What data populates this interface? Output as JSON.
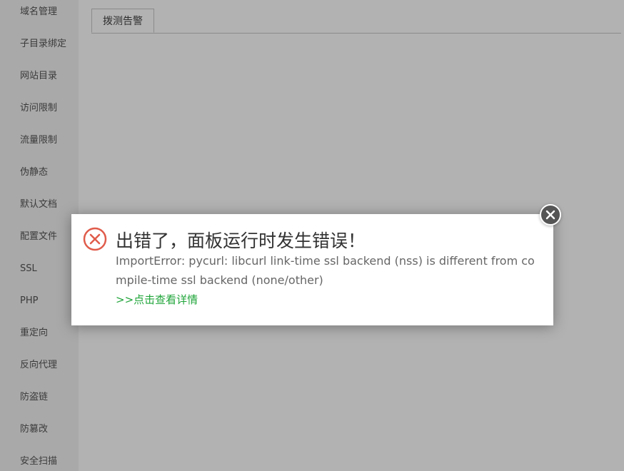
{
  "sidebar": {
    "items": [
      {
        "label": "域名管理"
      },
      {
        "label": "子目录绑定"
      },
      {
        "label": "网站目录"
      },
      {
        "label": "访问限制"
      },
      {
        "label": "流量限制"
      },
      {
        "label": "伪静态"
      },
      {
        "label": "默认文档"
      },
      {
        "label": "配置文件"
      },
      {
        "label": "SSL"
      },
      {
        "label": "PHP"
      },
      {
        "label": "重定向"
      },
      {
        "label": "反向代理"
      },
      {
        "label": "防盗链"
      },
      {
        "label": "防篡改"
      },
      {
        "label": "安全扫描"
      }
    ]
  },
  "main": {
    "tabs": [
      {
        "label": "拨测告警"
      }
    ]
  },
  "dialog": {
    "title": "出错了，面板运行时发生错误！",
    "message": "ImportError: pycurl: libcurl link-time ssl backend (nss) is different from compile-time ssl backend (none/other)",
    "link_label": ">>点击查看详情",
    "icons": {
      "error": "error-circle-x-icon",
      "close": "close-icon"
    }
  },
  "colors": {
    "error_red": "#e05c4b",
    "link_green": "#20a53a",
    "close_bg": "#555555"
  }
}
